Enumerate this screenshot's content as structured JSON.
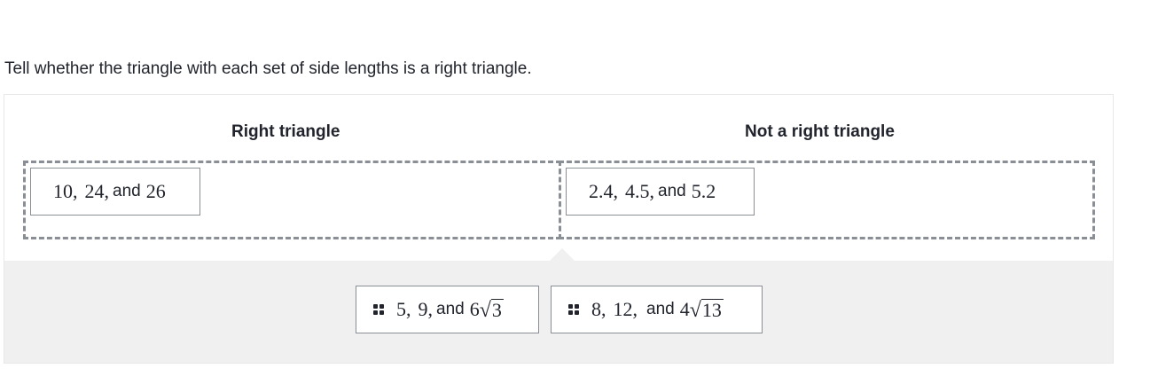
{
  "prompt": "Tell whether the triangle with each set of side lengths is a right triangle.",
  "categories": [
    {
      "header": "Right triangle",
      "items": [
        {
          "a": "10,",
          "b": "24,",
          "and": "and",
          "c": "26"
        }
      ]
    },
    {
      "header": "Not a right triangle",
      "items": [
        {
          "a": "2.4,",
          "b": "4.5,",
          "and": "and",
          "c": "5.2"
        }
      ]
    }
  ],
  "tray": {
    "cards": [
      {
        "a": "5,",
        "b": "9,",
        "and": "and",
        "coef": "6",
        "radicand": "3",
        "grip_icon": "drag-handle-icon"
      },
      {
        "a": "8,",
        "b": "12,",
        "and": "and",
        "coef": "4",
        "radicand": "13",
        "grip_icon": "drag-handle-icon"
      }
    ]
  },
  "colors": {
    "text": "#21242c",
    "border": "#8a8e95",
    "tray_bg": "#f0f0f0",
    "widget_border": "#e7e8ea"
  }
}
